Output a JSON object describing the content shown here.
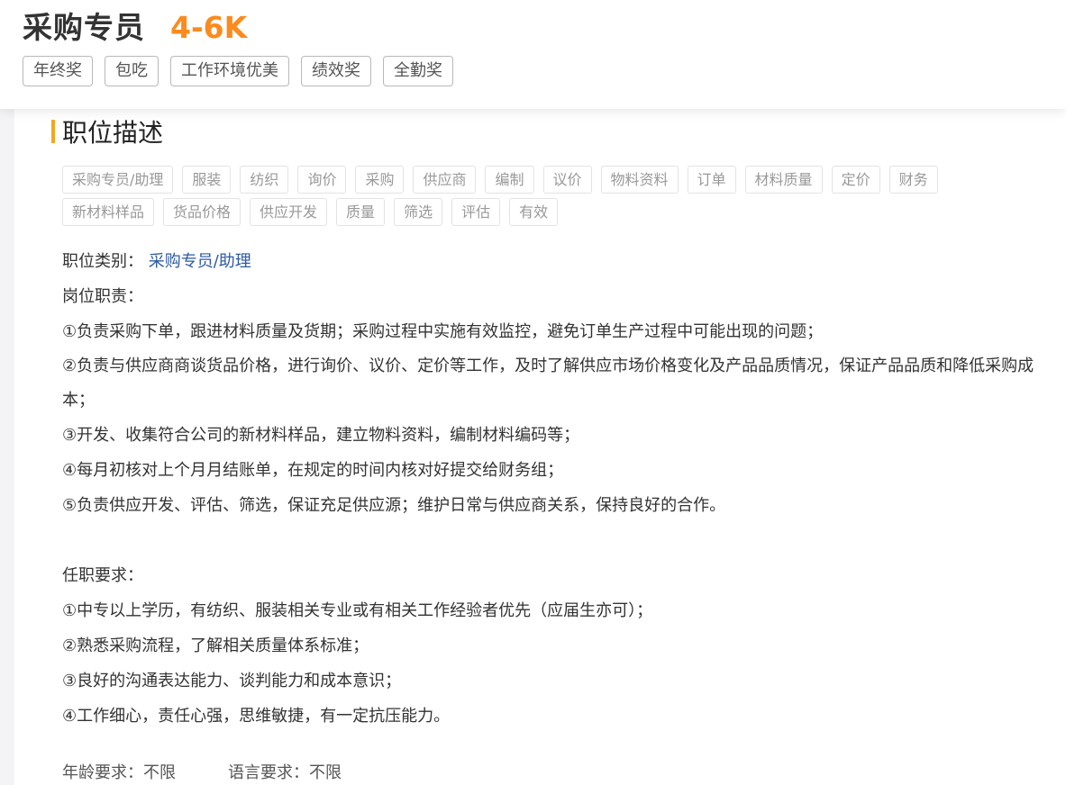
{
  "header": {
    "title": "采购专员",
    "salary": "4-6K",
    "benefits": [
      "年终奖",
      "包吃",
      "工作环境优美",
      "绩效奖",
      "全勤奖"
    ]
  },
  "section": {
    "title": "职位描述",
    "keywords_row1": [
      "采购专员/助理",
      "服装",
      "纺织",
      "询价",
      "采购",
      "供应商",
      "编制",
      "议价",
      "物料资料",
      "订单",
      "材料质量",
      "定价",
      "财务"
    ],
    "keywords_row2": [
      "新材料样品",
      "货品价格",
      "供应开发",
      "质量",
      "筛选",
      "评估",
      "有效"
    ]
  },
  "details": {
    "category_label": "职位类别：",
    "category_value": "采购专员/助理",
    "duties_heading": "岗位职责：",
    "duties": [
      "①负责采购下单，跟进材料质量及货期；采购过程中实施有效监控，避免订单生产过程中可能出现的问题；",
      "②负责与供应商商谈货品价格，进行询价、议价、定价等工作，及时了解供应市场价格变化及产品品质情况，保证产品品质和降低采购成本；",
      "③开发、收集符合公司的新材料样品，建立物料资料，编制材料编码等；",
      "④每月初核对上个月月结账单，在规定的时间内核对好提交给财务组；",
      "⑤负责供应开发、评估、筛选，保证充足供应源；维护日常与供应商关系，保持良好的合作。"
    ],
    "requirements_heading": "任职要求：",
    "requirements": [
      "①中专以上学历，有纺织、服装相关专业或有相关工作经验者优先（应届生亦可）；",
      "②熟悉采购流程，了解相关质量体系标准；",
      "③良好的沟通表达能力、谈判能力和成本意识；",
      "④工作细心，责任心强，思维敏捷，有一定抗压能力。"
    ]
  },
  "meta": {
    "age": "年龄要求：不限",
    "language": "语言要求：不限"
  },
  "colors": {
    "salary": "#fc8a1e",
    "accent_bar": "#f5a623",
    "link": "#2d5aa6"
  }
}
